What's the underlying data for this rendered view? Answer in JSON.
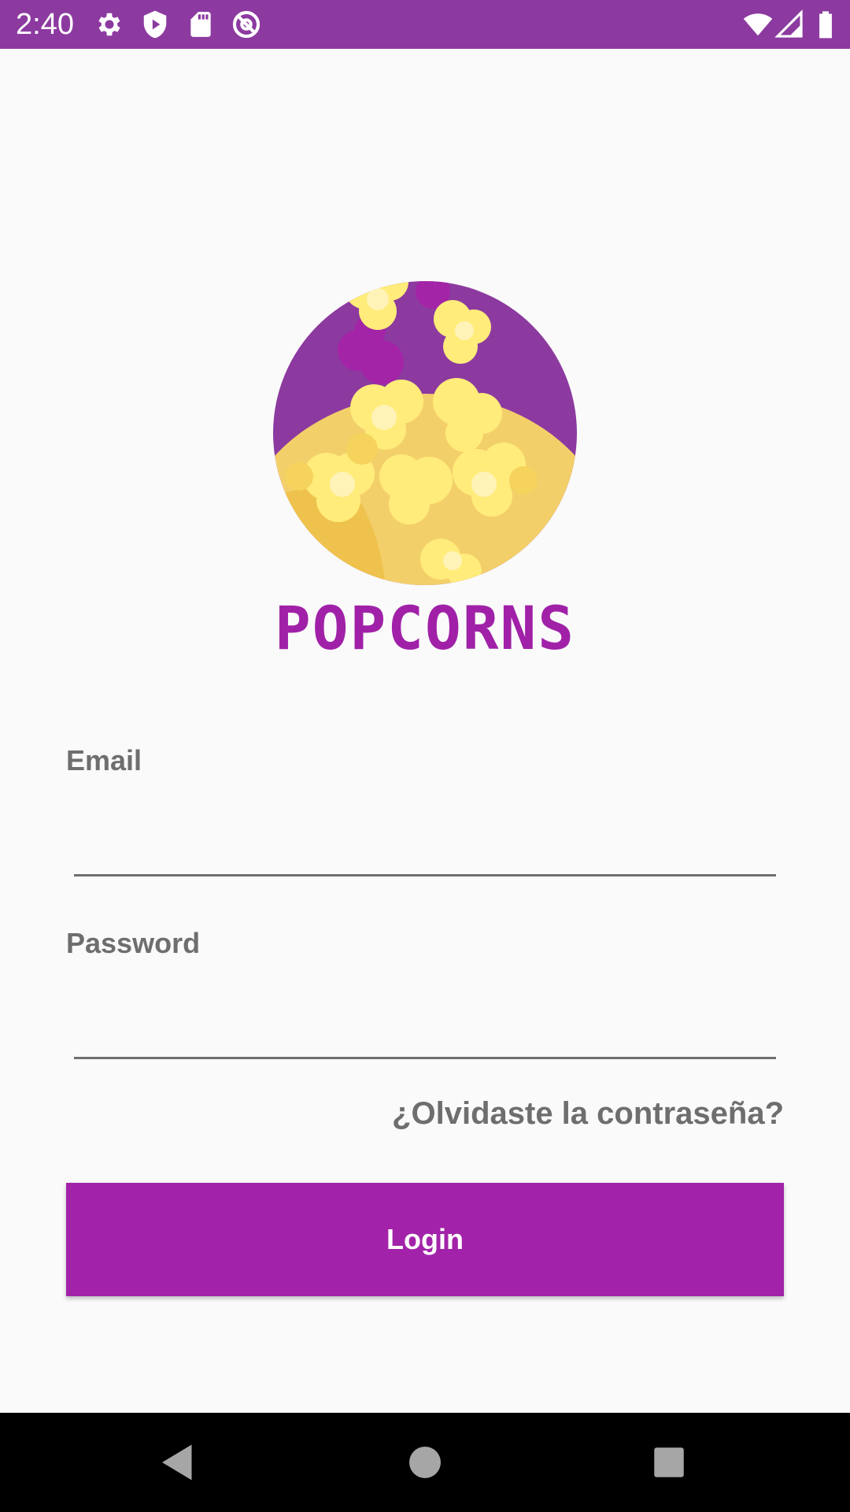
{
  "status_bar": {
    "time": "2:40",
    "icons_left": [
      "settings-icon",
      "play-protect-icon",
      "sd-card-icon",
      "at-sign-icon"
    ],
    "icons_right": [
      "wifi-icon",
      "signal-icon",
      "battery-icon"
    ],
    "background_color": "#8c3aa0"
  },
  "brand": {
    "name": "POPCORNS",
    "color": "#a021a8",
    "logo": "popcorn-bowl-logo"
  },
  "form": {
    "email_label": "Email",
    "email_value": "",
    "password_label": "Password",
    "password_value": "",
    "forgot_password": "¿Olvidaste la contraseña?",
    "login_label": "Login",
    "button_color": "#a223a9"
  },
  "nav_bar": {
    "buttons": [
      "back-icon",
      "home-icon",
      "recents-icon"
    ]
  }
}
